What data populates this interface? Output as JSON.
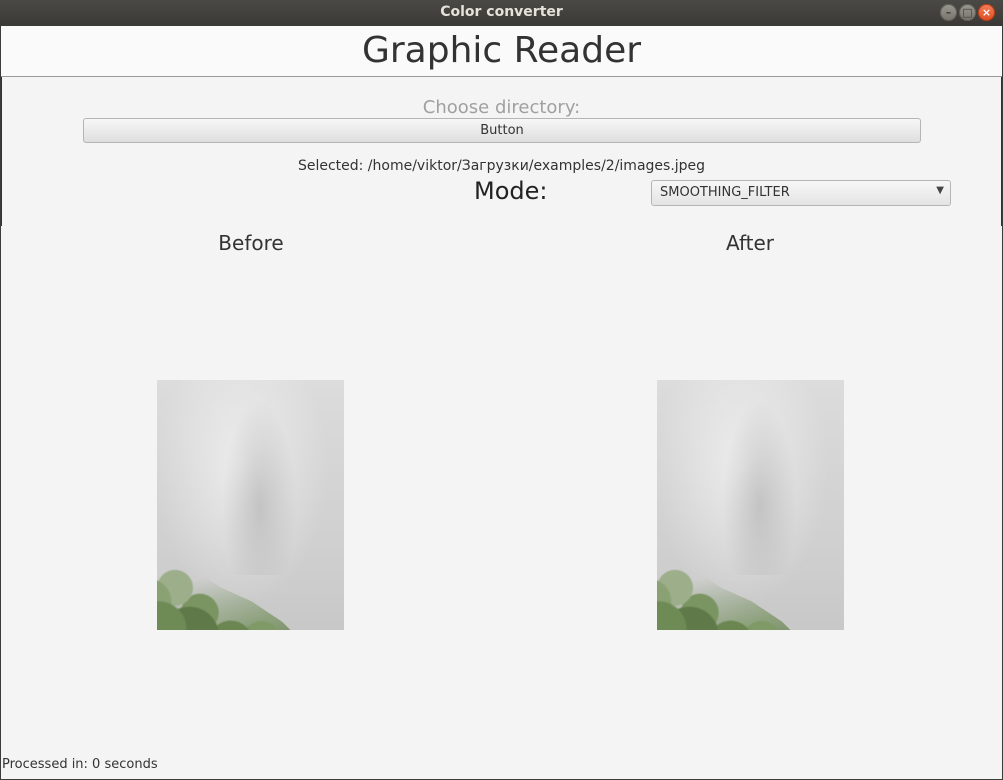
{
  "window": {
    "title": "Color converter"
  },
  "header": {
    "title": "Graphic Reader"
  },
  "chooser": {
    "label": "Choose directory:",
    "button_label": "Button",
    "selected_text": "Selected: /home/viktor/Загрузки/examples/2/images.jpeg"
  },
  "mode": {
    "label": "Mode:",
    "selected": "SMOOTHING_FILTER"
  },
  "preview": {
    "before_label": "Before",
    "after_label": "After"
  },
  "status": {
    "text": "Processed in: 0 seconds"
  },
  "icons": {
    "close": "close-icon",
    "maximize": "maximize-icon",
    "minimize": "minimize-icon",
    "dropdown": "chevron-down-icon"
  },
  "colors": {
    "titlebar": "#3c3b37",
    "close_button": "#e95420",
    "background": "#f4f4f4"
  }
}
